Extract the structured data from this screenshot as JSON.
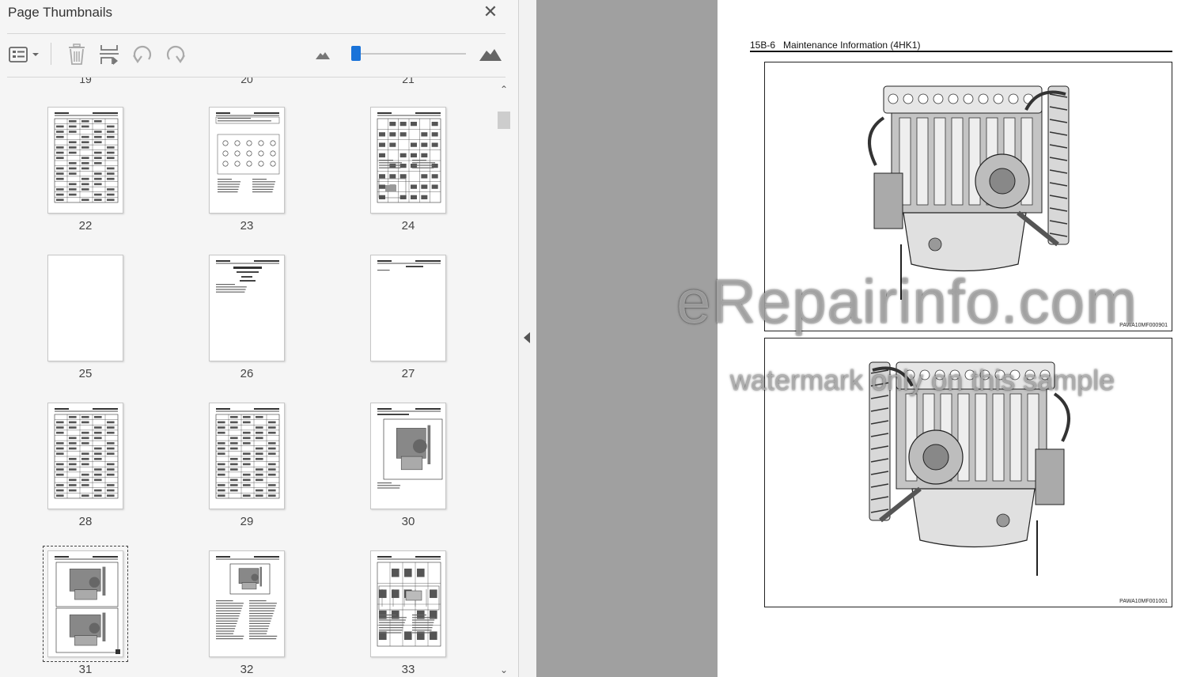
{
  "panel": {
    "title": "Page Thumbnails",
    "close_icon": "close-icon",
    "toolbar": {
      "options_icon": "thumbnail-options-icon",
      "delete_icon": "trash-icon",
      "insert_icon": "insert-pages-icon",
      "rotate_ccw_icon": "rotate-counterclockwise-icon",
      "rotate_cw_icon": "rotate-clockwise-icon",
      "zoom_out_icon": "zoom-out-mountain-icon",
      "zoom_in_icon": "zoom-in-mountain-icon",
      "zoom_level": 0.03
    },
    "partial_page_numbers": [
      "19",
      "20",
      "21"
    ],
    "thumbnails": [
      {
        "page": "22",
        "kind": "table"
      },
      {
        "page": "23",
        "kind": "diagram"
      },
      {
        "page": "24",
        "kind": "table-figure"
      },
      {
        "page": "25",
        "kind": "blank"
      },
      {
        "page": "26",
        "kind": "title"
      },
      {
        "page": "27",
        "kind": "text"
      },
      {
        "page": "28",
        "kind": "table"
      },
      {
        "page": "29",
        "kind": "table"
      },
      {
        "page": "30",
        "kind": "figure"
      },
      {
        "page": "31",
        "kind": "two-figures",
        "selected": true
      },
      {
        "page": "32",
        "kind": "figure-text"
      },
      {
        "page": "33",
        "kind": "schematic"
      }
    ]
  },
  "document": {
    "header": "15B-6   Maintenance Information (4HK1)",
    "figures": [
      {
        "code": "PAWA10MF000901",
        "content": "engine-side-view"
      },
      {
        "code": "PAWA10MF001001",
        "content": "engine-other-side-view"
      }
    ]
  },
  "watermark": {
    "main": "eRepairinfo.com",
    "sub": "watermark only on this sample"
  }
}
